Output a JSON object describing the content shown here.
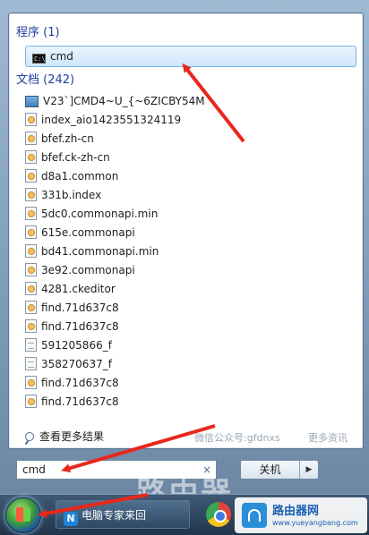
{
  "programs": {
    "header": "程序 (1)",
    "item": "cmd"
  },
  "documents": {
    "header": "文档 (242)",
    "items": [
      {
        "label": "V23`]CMD4~U_{~6ZICBY54M",
        "icon": "image-file-icon"
      },
      {
        "label": "index_aio1423551324119",
        "icon": "web-document-icon"
      },
      {
        "label": "bfef.zh-cn",
        "icon": "web-document-icon"
      },
      {
        "label": "bfef.ck-zh-cn",
        "icon": "web-document-icon"
      },
      {
        "label": "d8a1.common",
        "icon": "web-document-icon"
      },
      {
        "label": "331b.index",
        "icon": "web-document-icon"
      },
      {
        "label": "5dc0.commonapi.min",
        "icon": "web-document-icon"
      },
      {
        "label": "615e.commonapi",
        "icon": "web-document-icon"
      },
      {
        "label": "bd41.commonapi.min",
        "icon": "web-document-icon"
      },
      {
        "label": "3e92.commonapi",
        "icon": "web-document-icon"
      },
      {
        "label": "4281.ckeditor",
        "icon": "web-document-icon"
      },
      {
        "label": "find.71d637c8",
        "icon": "web-document-icon"
      },
      {
        "label": "find.71d637c8",
        "icon": "web-document-icon"
      },
      {
        "label": "591205866_f",
        "icon": "text-file-icon"
      },
      {
        "label": "358270637_f",
        "icon": "text-file-icon"
      },
      {
        "label": "find.71d637c8",
        "icon": "web-document-icon"
      },
      {
        "label": "find.71d637c8",
        "icon": "web-document-icon"
      }
    ]
  },
  "see_more": "查看更多结果",
  "watermark_left": "微信公众号:gfdnxs",
  "watermark_right": "更多资讯",
  "search": {
    "value": "cmd",
    "clear_icon": "×"
  },
  "shutdown": {
    "label": "关机",
    "arrow": "▶"
  },
  "taskbar": {
    "app_label": "电脑专家来回",
    "app_icon_letter": "N"
  },
  "brand": {
    "name": "路由器网",
    "url": "www.yueyangbang.com"
  },
  "ghost_text": "路由器",
  "colors": {
    "arrow": "#e8271c",
    "header": "#1e3f9c",
    "highlight": "#cfe6fc"
  }
}
